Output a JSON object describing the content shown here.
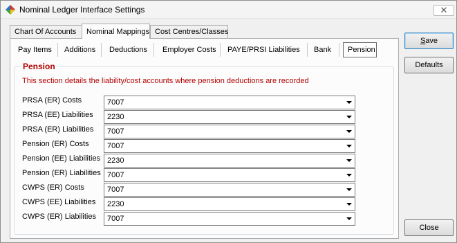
{
  "window": {
    "title": "Nominal Ledger Interface Settings",
    "close_glyph": "✕"
  },
  "tabs": [
    {
      "label": "Chart Of Accounts",
      "active": false
    },
    {
      "label": "Nominal Mappings",
      "active": true
    },
    {
      "label": "Cost Centres/Classes",
      "active": false
    }
  ],
  "subtabs": [
    {
      "label": "Pay Items",
      "active": false
    },
    {
      "label": "Additions",
      "active": false
    },
    {
      "label": "Deductions",
      "active": false
    },
    {
      "label": "Employer Costs",
      "active": false
    },
    {
      "label": "PAYE/PRSI Liabilities",
      "active": false
    },
    {
      "label": "Bank",
      "active": false
    },
    {
      "label": "Pension",
      "active": true
    }
  ],
  "section": {
    "title": "Pension",
    "description": "This section details the liability/cost accounts where pension deductions are recorded"
  },
  "rows": [
    {
      "label": "PRSA (ER) Costs",
      "value": "7007"
    },
    {
      "label": "PRSA (EE) Liabilities",
      "value": "2230"
    },
    {
      "label": "PRSA (ER) Liabilities",
      "value": "7007"
    },
    {
      "label": "Pension (ER) Costs",
      "value": "7007"
    },
    {
      "label": "Pension (EE) Liabilities",
      "value": "2230"
    },
    {
      "label": "Pension (ER) Liabilities",
      "value": "7007"
    },
    {
      "label": "CWPS (ER) Costs",
      "value": "7007"
    },
    {
      "label": "CWPS (EE) Liabilities",
      "value": "2230"
    },
    {
      "label": "CWPS (ER) Liabilities",
      "value": "7007"
    }
  ],
  "buttons": {
    "save_mnemonic": "S",
    "save_rest": "ave",
    "defaults": "Defaults",
    "close": "Close"
  },
  "colors": {
    "section_title": "#b20000",
    "description": "#b20000",
    "icon_blue": "#2a6fc9",
    "icon_red": "#d63a2a",
    "icon_yellow": "#f2c318",
    "icon_green": "#3aa53a"
  }
}
